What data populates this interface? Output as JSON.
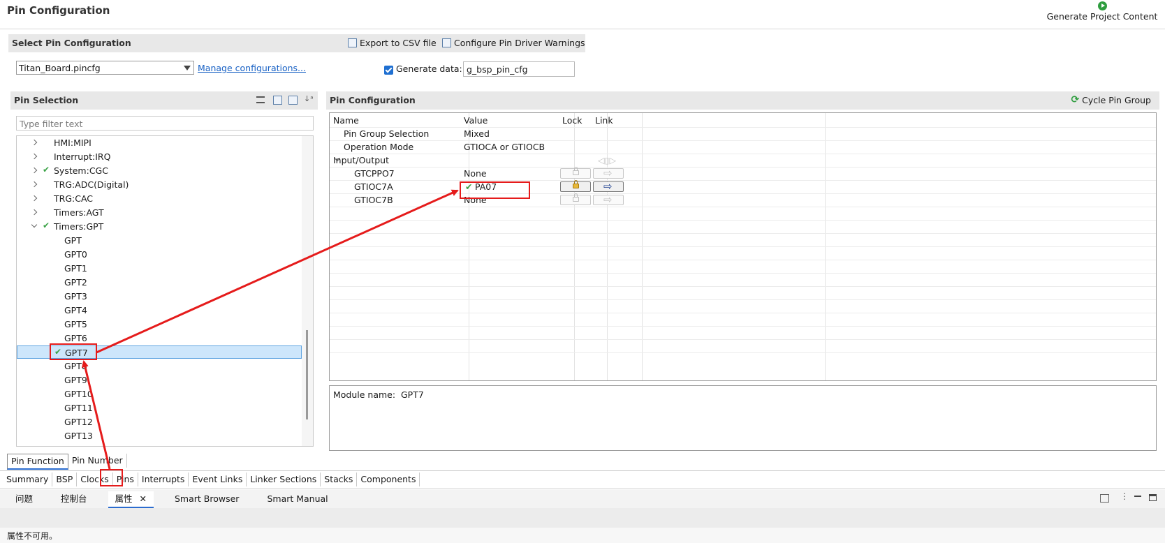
{
  "header": {
    "title": "Pin Configuration",
    "generate_label": "Generate Project Content"
  },
  "select_config": {
    "title": "Select Pin Configuration",
    "export_label": "Export to CSV file",
    "warnings_label": "Configure Pin Driver Warnings",
    "file_value": "Titan_Board.pincfg",
    "manage_label": "Manage configurations...",
    "generate_data_label": "Generate data:",
    "generate_data_value": "g_bsp_pin_cfg"
  },
  "pin_selection": {
    "title": "Pin Selection",
    "filter_placeholder": "Type filter text",
    "items": [
      {
        "label": "HMI:MIPI",
        "level": 0,
        "expander": "right",
        "checked": false
      },
      {
        "label": "Interrupt:IRQ",
        "level": 0,
        "expander": "right",
        "checked": false
      },
      {
        "label": "System:CGC",
        "level": 0,
        "expander": "right",
        "checked": true
      },
      {
        "label": "TRG:ADC(Digital)",
        "level": 0,
        "expander": "right",
        "checked": false
      },
      {
        "label": "TRG:CAC",
        "level": 0,
        "expander": "right",
        "checked": false
      },
      {
        "label": "Timers:AGT",
        "level": 0,
        "expander": "right",
        "checked": false
      },
      {
        "label": "Timers:GPT",
        "level": 0,
        "expander": "down",
        "checked": true
      },
      {
        "label": "GPT",
        "level": 1,
        "checked": false
      },
      {
        "label": "GPT0",
        "level": 1,
        "checked": false
      },
      {
        "label": "GPT1",
        "level": 1,
        "checked": false
      },
      {
        "label": "GPT2",
        "level": 1,
        "checked": false
      },
      {
        "label": "GPT3",
        "level": 1,
        "checked": false
      },
      {
        "label": "GPT4",
        "level": 1,
        "checked": false
      },
      {
        "label": "GPT5",
        "level": 1,
        "checked": false
      },
      {
        "label": "GPT6",
        "level": 1,
        "checked": false
      },
      {
        "label": "GPT7",
        "level": 1,
        "checked": true,
        "selected": true
      },
      {
        "label": "GPT8",
        "level": 1,
        "checked": false
      },
      {
        "label": "GPT9",
        "level": 1,
        "checked": false
      },
      {
        "label": "GPT10",
        "level": 1,
        "checked": false
      },
      {
        "label": "GPT11",
        "level": 1,
        "checked": false
      },
      {
        "label": "GPT12",
        "level": 1,
        "checked": false
      },
      {
        "label": "GPT13",
        "level": 1,
        "checked": false
      }
    ]
  },
  "pin_config": {
    "title": "Pin Configuration",
    "cycle_label": "Cycle Pin Group",
    "columns": [
      "Name",
      "Value",
      "Lock",
      "Link"
    ],
    "rows": [
      {
        "name": "Pin Group Selection",
        "value": "Mixed",
        "indent": 1
      },
      {
        "name": "Operation Mode",
        "value": "GTIOCA or GTIOCB",
        "indent": 1
      },
      {
        "name": "Input/Output",
        "value": "",
        "indent": 0,
        "expander": true
      },
      {
        "name": "GTCPPO7",
        "value": "None",
        "indent": 2,
        "buttons": "disabled"
      },
      {
        "name": "GTIOC7A",
        "value": "PA07",
        "indent": 2,
        "buttons": "active",
        "checked": true
      },
      {
        "name": "GTIOC7B",
        "value": "None",
        "indent": 2,
        "buttons": "disabled"
      }
    ],
    "module_label": "Module name:",
    "module_value": "GPT7"
  },
  "pin_tabs": [
    "Pin Function",
    "Pin Number"
  ],
  "editor_tabs": [
    "Summary",
    "BSP",
    "Clocks",
    "Pins",
    "Interrupts",
    "Event Links",
    "Linker Sections",
    "Stacks",
    "Components"
  ],
  "bottom_tabs": [
    "问题",
    "控制台",
    "属性",
    "Smart Browser",
    "Smart Manual"
  ],
  "status_text": "属性不可用。",
  "colors": {
    "highlight": "#e51b1b",
    "check": "#3aa246",
    "link": "#1760c4"
  }
}
